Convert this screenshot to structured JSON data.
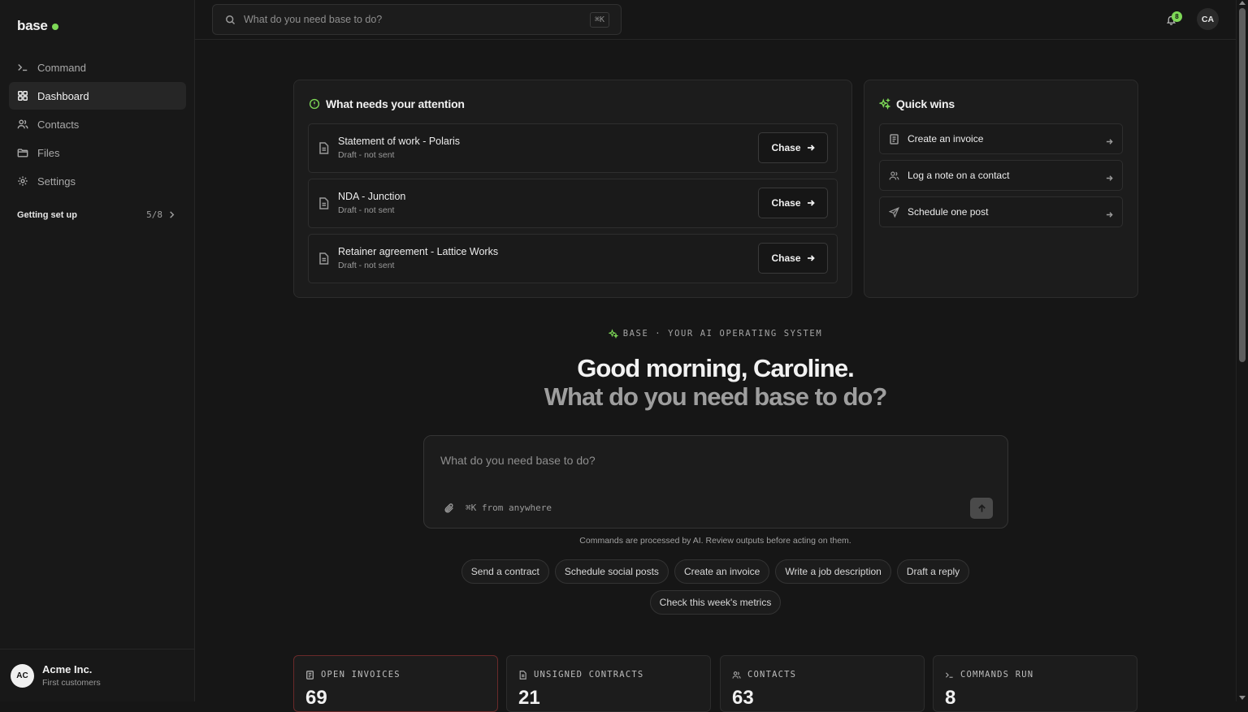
{
  "sidebar": {
    "brand": "base",
    "nav": [
      {
        "label": "Command",
        "icon": "terminal-icon",
        "active": false
      },
      {
        "label": "Dashboard",
        "icon": "grid-icon",
        "active": true
      },
      {
        "label": "Contacts",
        "icon": "users-icon",
        "active": false
      },
      {
        "label": "Files",
        "icon": "folder-icon",
        "active": false
      },
      {
        "label": "Settings",
        "icon": "gear-icon",
        "active": false
      }
    ],
    "setup": {
      "label": "Getting set up",
      "progress": "5/8"
    },
    "org": {
      "avatar": "AC",
      "name": "Acme Inc.",
      "sub": "First customers"
    }
  },
  "topbar": {
    "search_placeholder": "What do you need base to do?",
    "shortcut": "⌘K",
    "notifications": "8",
    "user_initials": "CA"
  },
  "attention": {
    "title": "What needs your attention",
    "items": [
      {
        "title": "Statement of work - Polaris",
        "status": "Draft - not sent",
        "action": "Chase"
      },
      {
        "title": "NDA - Junction",
        "status": "Draft - not sent",
        "action": "Chase"
      },
      {
        "title": "Retainer agreement - Lattice Works",
        "status": "Draft - not sent",
        "action": "Chase"
      }
    ]
  },
  "quick_wins": {
    "title": "Quick wins",
    "items": [
      {
        "label": "Create an invoice",
        "icon": "invoice-icon"
      },
      {
        "label": "Log a note on a contact",
        "icon": "users-icon"
      },
      {
        "label": "Schedule one post",
        "icon": "send-icon"
      }
    ]
  },
  "hero": {
    "eyebrow": "BASE · YOUR AI OPERATING SYSTEM",
    "greeting": "Good morning, Caroline.",
    "subheading": "What do you need base to do?"
  },
  "composer": {
    "placeholder": "What do you need base to do?",
    "hint": "⌘K from anywhere",
    "disclaimer": "Commands are processed by AI. Review outputs before acting on them."
  },
  "suggestions": [
    "Send a contract",
    "Schedule social posts",
    "Create an invoice",
    "Write a job description",
    "Draft a reply",
    "Check this week's metrics"
  ],
  "stats": [
    {
      "label": "OPEN INVOICES",
      "value": "69",
      "icon": "invoice-icon"
    },
    {
      "label": "UNSIGNED CONTRACTS",
      "value": "21",
      "icon": "document-icon"
    },
    {
      "label": "CONTACTS",
      "value": "63",
      "icon": "users-icon"
    },
    {
      "label": "COMMANDS RUN",
      "value": "8",
      "icon": "terminal-icon"
    }
  ],
  "colors": {
    "accent": "#7ed957",
    "background": "#161616",
    "panel": "#1c1c1c",
    "alert_border": "#6a2a2a"
  }
}
